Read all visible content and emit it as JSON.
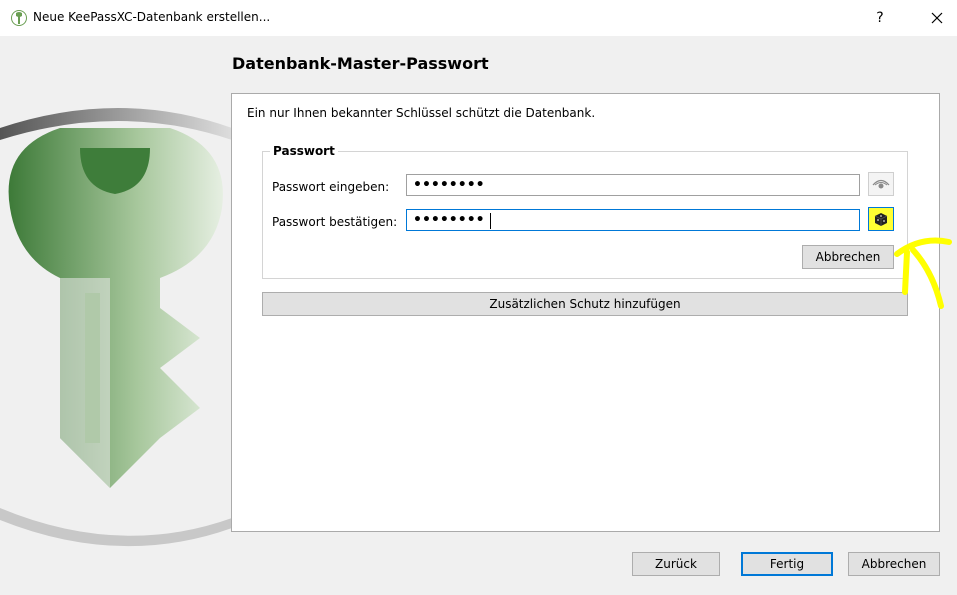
{
  "window": {
    "title": "Neue KeePassXC-Datenbank erstellen...",
    "help_label": "?",
    "close_icon": "close-icon"
  },
  "page": {
    "title": "Datenbank-Master-Passwort",
    "description": "Ein nur Ihnen bekannter Schlüssel schützt die Datenbank."
  },
  "password_group": {
    "legend": "Passwort",
    "enter_label": "Passwort eingeben:",
    "enter_value": "••••••••",
    "confirm_label": "Passwort bestätigen:",
    "confirm_value": "••••••••",
    "show_password_icon": "eye-icon",
    "generate_password_icon": "dice-icon",
    "cancel_label": "Abbrechen"
  },
  "add_protection_label": "Zusätzlichen Schutz hinzufügen",
  "footer": {
    "back_label": "Zurück",
    "finish_label": "Fertig",
    "cancel_label": "Abbrechen"
  },
  "colors": {
    "accent": "#0078d7",
    "highlight": "#ffff00",
    "brand_green": "#6a9e53"
  }
}
